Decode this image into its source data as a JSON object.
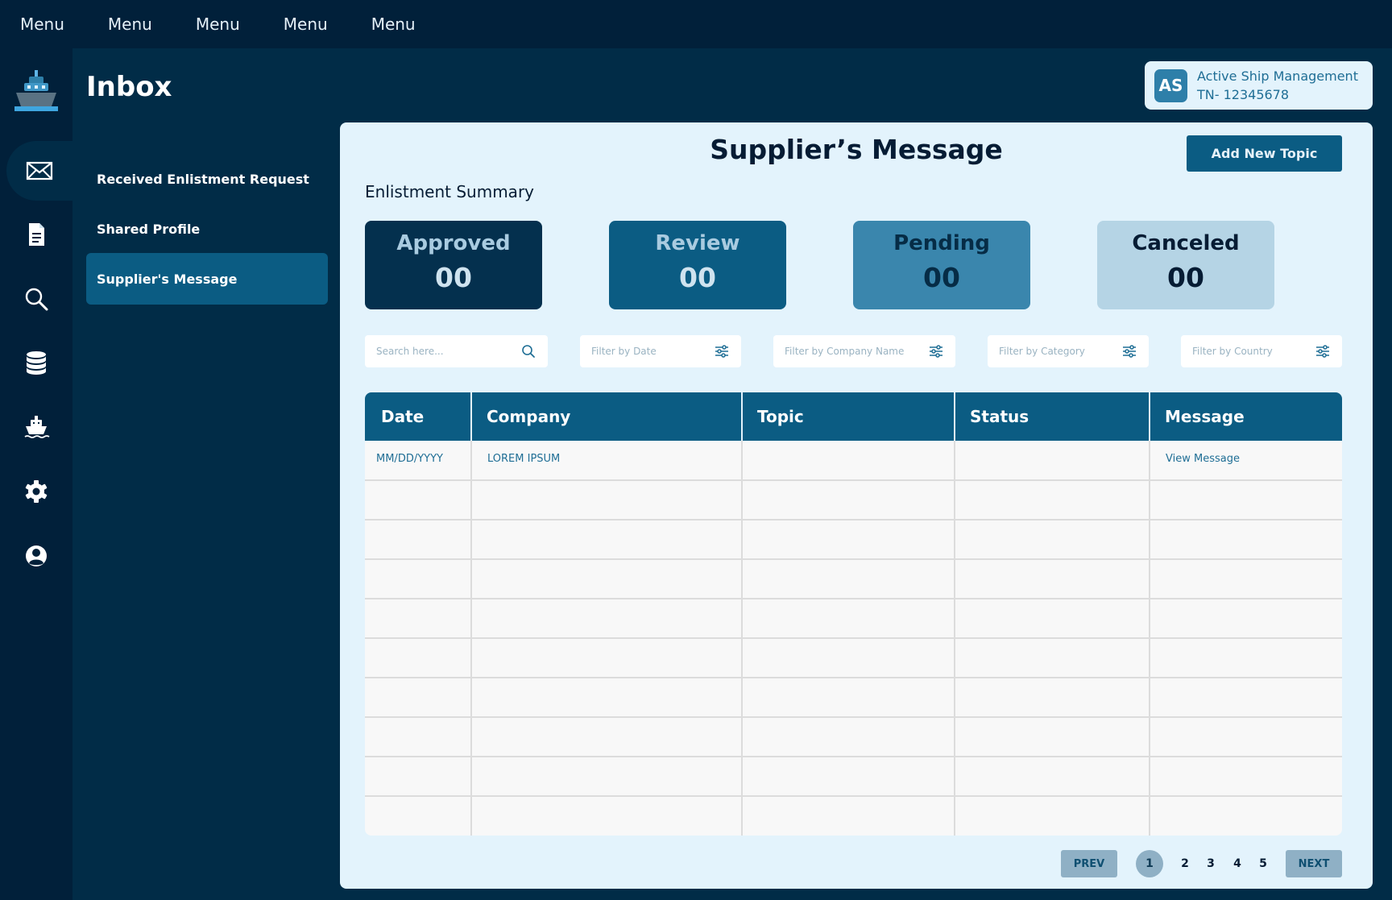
{
  "top_menu": [
    "Menu",
    "Menu",
    "Menu",
    "Menu",
    "Menu"
  ],
  "page_title": "Inbox",
  "nav": {
    "items": [
      {
        "label": "Received Enlistment Request",
        "active": false
      },
      {
        "label": "Shared Profile",
        "active": false
      },
      {
        "label": "Supplier's Message",
        "active": true
      }
    ]
  },
  "account": {
    "initials": "AS",
    "name": "Active Ship Management",
    "id": "TN- 12345678"
  },
  "panel": {
    "title": "Supplier’s Message",
    "add_button": "Add New Topic",
    "summary_label": "Enlistment Summary"
  },
  "summary_cards": [
    {
      "label": "Approved",
      "count": "00",
      "bg": "#04304e",
      "fg": "#a9cbe0",
      "count_fg": "#cfe3ef"
    },
    {
      "label": "Review",
      "count": "00",
      "bg": "#0b5c83",
      "fg": "#a9cbe0",
      "count_fg": "#cfe3ef"
    },
    {
      "label": "Pending",
      "count": "00",
      "bg": "#3a86ad",
      "fg": "#062c46",
      "count_fg": "#062c46"
    },
    {
      "label": "Canceled",
      "count": "00",
      "bg": "#b5d4e5",
      "fg": "#061c34",
      "count_fg": "#061c34"
    }
  ],
  "filters": {
    "search": "Search here...",
    "date": "Filter by Date",
    "company": "Filter by Company Name",
    "category": "Filter by Category",
    "country": "Filter by Country"
  },
  "table": {
    "columns": [
      "Date",
      "Company",
      "Topic",
      "Status",
      "Message"
    ],
    "rows": [
      {
        "date": "MM/DD/YYYY",
        "company": "LOREM IPSUM",
        "topic": "",
        "status": "",
        "message": "View Message"
      }
    ]
  },
  "pagination": {
    "prev": "PREV",
    "next": "NEXT",
    "pages": [
      "1",
      "2",
      "3",
      "4",
      "5"
    ],
    "current": "1"
  },
  "colors": {
    "accent": "#0b5c83",
    "sidebar": "#01203a",
    "background": "#012c47",
    "panel": "#e3f3fc"
  },
  "icons": [
    "ship-logo-icon",
    "mail-icon",
    "document-icon",
    "search-icon",
    "database-icon",
    "ship-icon",
    "gear-icon",
    "user-icon"
  ]
}
